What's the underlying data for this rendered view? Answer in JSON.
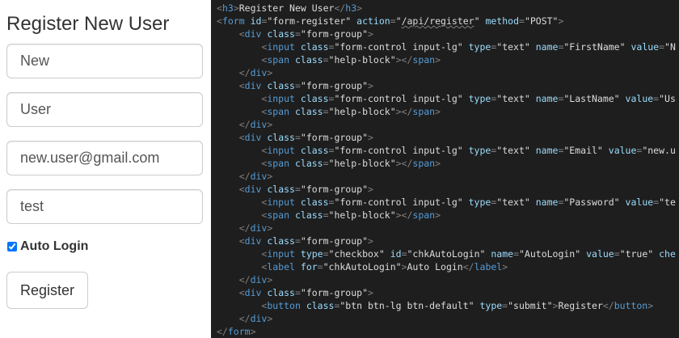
{
  "form": {
    "title": "Register New User",
    "first_name_value": "New",
    "last_name_value": "User",
    "email_value": "new.user@gmail.com",
    "password_value": "test",
    "auto_login_checked": true,
    "auto_login_label": "Auto Login",
    "submit_label": "Register"
  },
  "code": {
    "lines": [
      [
        [
          "punc",
          "<"
        ],
        [
          "tag",
          "h3"
        ],
        [
          "punc",
          ">"
        ],
        [
          "text",
          "Register New User"
        ],
        [
          "punc",
          "</"
        ],
        [
          "tag",
          "h3"
        ],
        [
          "punc",
          ">"
        ]
      ],
      [
        [
          "punc",
          "<"
        ],
        [
          "tag",
          "form"
        ],
        [
          "val",
          " "
        ],
        [
          "attr",
          "id"
        ],
        [
          "punc",
          "="
        ],
        [
          "val",
          "\"form-register\" "
        ],
        [
          "attr",
          "action"
        ],
        [
          "punc",
          "="
        ],
        [
          "val",
          "\""
        ],
        [
          "link",
          "/api/register"
        ],
        [
          "val",
          "\" "
        ],
        [
          "attr",
          "method"
        ],
        [
          "punc",
          "="
        ],
        [
          "val",
          "\"POST\""
        ],
        [
          "punc",
          ">"
        ]
      ],
      [
        [
          "val",
          "    "
        ],
        [
          "punc",
          "<"
        ],
        [
          "tag",
          "div"
        ],
        [
          "val",
          " "
        ],
        [
          "attr",
          "class"
        ],
        [
          "punc",
          "="
        ],
        [
          "val",
          "\"form-group\""
        ],
        [
          "punc",
          ">"
        ]
      ],
      [
        [
          "val",
          "        "
        ],
        [
          "punc",
          "<"
        ],
        [
          "tag",
          "input"
        ],
        [
          "val",
          " "
        ],
        [
          "attr",
          "class"
        ],
        [
          "punc",
          "="
        ],
        [
          "val",
          "\"form-control input-lg\" "
        ],
        [
          "attr",
          "type"
        ],
        [
          "punc",
          "="
        ],
        [
          "val",
          "\"text\" "
        ],
        [
          "attr",
          "name"
        ],
        [
          "punc",
          "="
        ],
        [
          "val",
          "\"FirstName\" "
        ],
        [
          "attr",
          "value"
        ],
        [
          "punc",
          "="
        ],
        [
          "val",
          "\"N"
        ]
      ],
      [
        [
          "val",
          "        "
        ],
        [
          "punc",
          "<"
        ],
        [
          "tag",
          "span"
        ],
        [
          "val",
          " "
        ],
        [
          "attr",
          "class"
        ],
        [
          "punc",
          "="
        ],
        [
          "val",
          "\"help-block\""
        ],
        [
          "punc",
          "></"
        ],
        [
          "tag",
          "span"
        ],
        [
          "punc",
          ">"
        ]
      ],
      [
        [
          "val",
          "    "
        ],
        [
          "punc",
          "</"
        ],
        [
          "tag",
          "div"
        ],
        [
          "punc",
          ">"
        ]
      ],
      [
        [
          "val",
          "    "
        ],
        [
          "punc",
          "<"
        ],
        [
          "tag",
          "div"
        ],
        [
          "val",
          " "
        ],
        [
          "attr",
          "class"
        ],
        [
          "punc",
          "="
        ],
        [
          "val",
          "\"form-group\""
        ],
        [
          "punc",
          ">"
        ]
      ],
      [
        [
          "val",
          "        "
        ],
        [
          "punc",
          "<"
        ],
        [
          "tag",
          "input"
        ],
        [
          "val",
          " "
        ],
        [
          "attr",
          "class"
        ],
        [
          "punc",
          "="
        ],
        [
          "val",
          "\"form-control input-lg\" "
        ],
        [
          "attr",
          "type"
        ],
        [
          "punc",
          "="
        ],
        [
          "val",
          "\"text\" "
        ],
        [
          "attr",
          "name"
        ],
        [
          "punc",
          "="
        ],
        [
          "val",
          "\"LastName\" "
        ],
        [
          "attr",
          "value"
        ],
        [
          "punc",
          "="
        ],
        [
          "val",
          "\"Us"
        ]
      ],
      [
        [
          "val",
          "        "
        ],
        [
          "punc",
          "<"
        ],
        [
          "tag",
          "span"
        ],
        [
          "val",
          " "
        ],
        [
          "attr",
          "class"
        ],
        [
          "punc",
          "="
        ],
        [
          "val",
          "\"help-block\""
        ],
        [
          "punc",
          "></"
        ],
        [
          "tag",
          "span"
        ],
        [
          "punc",
          ">"
        ]
      ],
      [
        [
          "val",
          "    "
        ],
        [
          "punc",
          "</"
        ],
        [
          "tag",
          "div"
        ],
        [
          "punc",
          ">"
        ]
      ],
      [
        [
          "val",
          "    "
        ],
        [
          "punc",
          "<"
        ],
        [
          "tag",
          "div"
        ],
        [
          "val",
          " "
        ],
        [
          "attr",
          "class"
        ],
        [
          "punc",
          "="
        ],
        [
          "val",
          "\"form-group\""
        ],
        [
          "punc",
          ">"
        ]
      ],
      [
        [
          "val",
          "        "
        ],
        [
          "punc",
          "<"
        ],
        [
          "tag",
          "input"
        ],
        [
          "val",
          " "
        ],
        [
          "attr",
          "class"
        ],
        [
          "punc",
          "="
        ],
        [
          "val",
          "\"form-control input-lg\" "
        ],
        [
          "attr",
          "type"
        ],
        [
          "punc",
          "="
        ],
        [
          "val",
          "\"text\" "
        ],
        [
          "attr",
          "name"
        ],
        [
          "punc",
          "="
        ],
        [
          "val",
          "\"Email\" "
        ],
        [
          "attr",
          "value"
        ],
        [
          "punc",
          "="
        ],
        [
          "val",
          "\"new.u"
        ]
      ],
      [
        [
          "val",
          "        "
        ],
        [
          "punc",
          "<"
        ],
        [
          "tag",
          "span"
        ],
        [
          "val",
          " "
        ],
        [
          "attr",
          "class"
        ],
        [
          "punc",
          "="
        ],
        [
          "val",
          "\"help-block\""
        ],
        [
          "punc",
          "></"
        ],
        [
          "tag",
          "span"
        ],
        [
          "punc",
          ">"
        ]
      ],
      [
        [
          "val",
          "    "
        ],
        [
          "punc",
          "</"
        ],
        [
          "tag",
          "div"
        ],
        [
          "punc",
          ">"
        ]
      ],
      [
        [
          "val",
          "    "
        ],
        [
          "punc",
          "<"
        ],
        [
          "tag",
          "div"
        ],
        [
          "val",
          " "
        ],
        [
          "attr",
          "class"
        ],
        [
          "punc",
          "="
        ],
        [
          "val",
          "\"form-group\""
        ],
        [
          "punc",
          ">"
        ]
      ],
      [
        [
          "val",
          "        "
        ],
        [
          "punc",
          "<"
        ],
        [
          "tag",
          "input"
        ],
        [
          "val",
          " "
        ],
        [
          "attr",
          "class"
        ],
        [
          "punc",
          "="
        ],
        [
          "val",
          "\"form-control input-lg\" "
        ],
        [
          "attr",
          "type"
        ],
        [
          "punc",
          "="
        ],
        [
          "val",
          "\"text\" "
        ],
        [
          "attr",
          "name"
        ],
        [
          "punc",
          "="
        ],
        [
          "val",
          "\"Password\" "
        ],
        [
          "attr",
          "value"
        ],
        [
          "punc",
          "="
        ],
        [
          "val",
          "\"te"
        ]
      ],
      [
        [
          "val",
          "        "
        ],
        [
          "punc",
          "<"
        ],
        [
          "tag",
          "span"
        ],
        [
          "val",
          " "
        ],
        [
          "attr",
          "class"
        ],
        [
          "punc",
          "="
        ],
        [
          "val",
          "\"help-block\""
        ],
        [
          "punc",
          "></"
        ],
        [
          "tag",
          "span"
        ],
        [
          "punc",
          ">"
        ]
      ],
      [
        [
          "val",
          "    "
        ],
        [
          "punc",
          "</"
        ],
        [
          "tag",
          "div"
        ],
        [
          "punc",
          ">"
        ]
      ],
      [
        [
          "val",
          "    "
        ],
        [
          "punc",
          "<"
        ],
        [
          "tag",
          "div"
        ],
        [
          "val",
          " "
        ],
        [
          "attr",
          "class"
        ],
        [
          "punc",
          "="
        ],
        [
          "val",
          "\"form-group\""
        ],
        [
          "punc",
          ">"
        ]
      ],
      [
        [
          "val",
          "        "
        ],
        [
          "punc",
          "<"
        ],
        [
          "tag",
          "input"
        ],
        [
          "val",
          " "
        ],
        [
          "attr",
          "type"
        ],
        [
          "punc",
          "="
        ],
        [
          "val",
          "\"checkbox\" "
        ],
        [
          "attr",
          "id"
        ],
        [
          "punc",
          "="
        ],
        [
          "val",
          "\"chkAutoLogin\" "
        ],
        [
          "attr",
          "name"
        ],
        [
          "punc",
          "="
        ],
        [
          "val",
          "\"AutoLogin\" "
        ],
        [
          "attr",
          "value"
        ],
        [
          "punc",
          "="
        ],
        [
          "val",
          "\"true\" "
        ],
        [
          "attr",
          "che"
        ]
      ],
      [
        [
          "val",
          "        "
        ],
        [
          "punc",
          "<"
        ],
        [
          "tag",
          "label"
        ],
        [
          "val",
          " "
        ],
        [
          "attr",
          "for"
        ],
        [
          "punc",
          "="
        ],
        [
          "val",
          "\"chkAutoLogin\""
        ],
        [
          "punc",
          ">"
        ],
        [
          "text",
          "Auto Login"
        ],
        [
          "punc",
          "</"
        ],
        [
          "tag",
          "label"
        ],
        [
          "punc",
          ">"
        ]
      ],
      [
        [
          "val",
          "    "
        ],
        [
          "punc",
          "</"
        ],
        [
          "tag",
          "div"
        ],
        [
          "punc",
          ">"
        ]
      ],
      [
        [
          "val",
          "    "
        ],
        [
          "punc",
          "<"
        ],
        [
          "tag",
          "div"
        ],
        [
          "val",
          " "
        ],
        [
          "attr",
          "class"
        ],
        [
          "punc",
          "="
        ],
        [
          "val",
          "\"form-group\""
        ],
        [
          "punc",
          ">"
        ]
      ],
      [
        [
          "val",
          "        "
        ],
        [
          "punc",
          "<"
        ],
        [
          "tag",
          "button"
        ],
        [
          "val",
          " "
        ],
        [
          "attr",
          "class"
        ],
        [
          "punc",
          "="
        ],
        [
          "val",
          "\"btn btn-lg btn-default\" "
        ],
        [
          "attr",
          "type"
        ],
        [
          "punc",
          "="
        ],
        [
          "val",
          "\"submit\""
        ],
        [
          "punc",
          ">"
        ],
        [
          "text",
          "Register"
        ],
        [
          "punc",
          "</"
        ],
        [
          "tag",
          "button"
        ],
        [
          "punc",
          ">"
        ]
      ],
      [
        [
          "val",
          "    "
        ],
        [
          "punc",
          "</"
        ],
        [
          "tag",
          "div"
        ],
        [
          "punc",
          ">"
        ]
      ],
      [
        [
          "punc",
          "</"
        ],
        [
          "tag",
          "form"
        ],
        [
          "punc",
          ">"
        ]
      ]
    ]
  }
}
